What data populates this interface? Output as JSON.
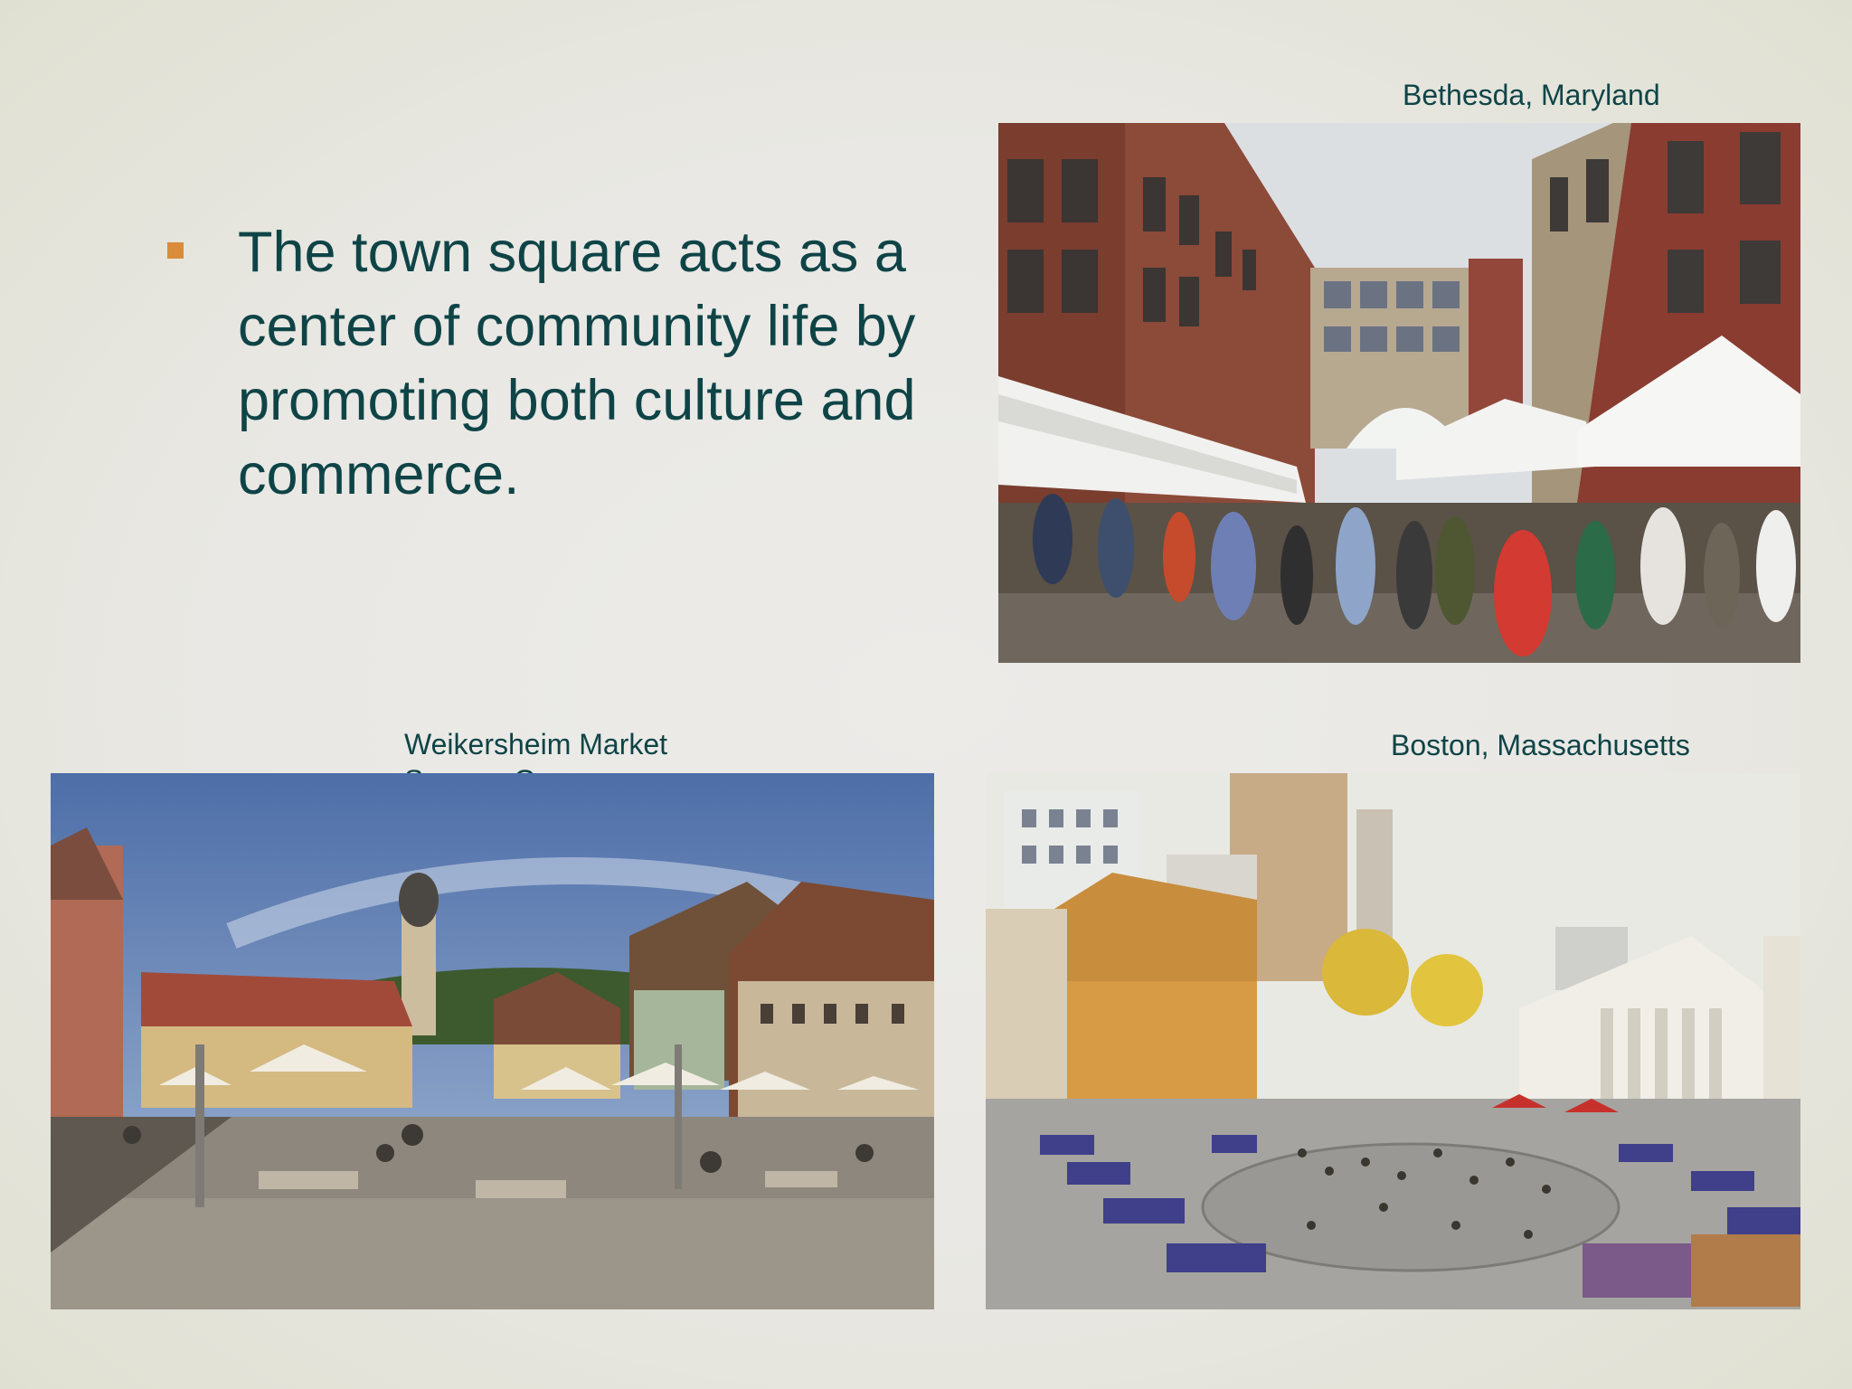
{
  "slide": {
    "bullet_text": "The town square acts as a center of community life by promoting both culture and commerce.",
    "captions": {
      "bethesda": "Bethesda, Maryland",
      "weikersheim": "Weikersheim Market Square, Germany",
      "boston": "Boston, Massachusetts"
    }
  },
  "colors": {
    "text": "#0f4447",
    "bullet": "#d98c3a",
    "background": "#ebeae6"
  }
}
